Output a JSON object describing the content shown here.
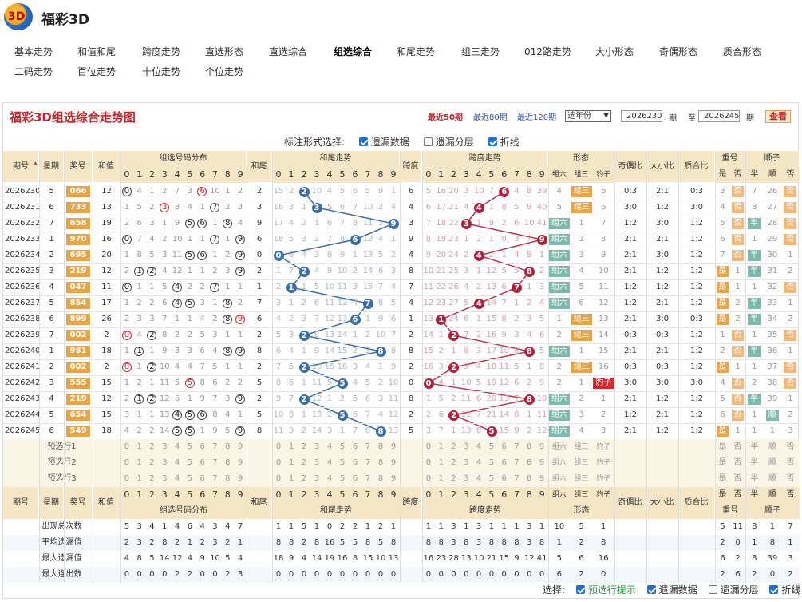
{
  "app": {
    "title": "福彩3D",
    "logo": "3D"
  },
  "nav": [
    [
      "基本走势",
      "和值和尾",
      "跨度走势",
      "直选形态",
      "直选综合",
      "组选综合",
      "和尾走势",
      "组三走势",
      "012路走势",
      "大小形态",
      "奇偶形态",
      "质合形态"
    ],
    [
      "二码走势",
      "百位走势",
      "十位走势",
      "个位走势"
    ]
  ],
  "nav_active": "组选综合",
  "panel": {
    "title": "福彩3D组选综合走势图",
    "ranges": [
      "最近50期",
      "最近80期",
      "最近120期"
    ],
    "year_select": "选年份",
    "from_label": "期",
    "to_label": "至",
    "to_suffix": "期",
    "from": "2026230",
    "to": "2026245",
    "query": "查看",
    "marker_label": "标注形式选择:",
    "marker_opts": [
      {
        "label": "遗漏数据",
        "on": true
      },
      {
        "label": "遗漏分层",
        "on": false
      },
      {
        "label": "折线",
        "on": true
      }
    ]
  },
  "columns": {
    "period": "期号",
    "week": "星期",
    "number": "奖号",
    "sum": "和值",
    "group": "组选号码分布",
    "tail": "和尾",
    "tail_trend": "和尾走势",
    "span": "跨度",
    "span_trend": "跨度走势",
    "form": "形态",
    "oe": "奇偶比",
    "bs": "大小比",
    "pc": "质合比",
    "dup": "重号",
    "seq": "顺子",
    "form_sub": [
      "组六",
      "组三",
      "豹子"
    ],
    "dup_sub": [
      "是",
      "否"
    ],
    "seq_sub": [
      "半",
      "顺",
      "否"
    ],
    "digits": [
      "0",
      "1",
      "2",
      "3",
      "4",
      "5",
      "6",
      "7",
      "8",
      "9"
    ]
  },
  "rows": [
    {
      "p": "2026230",
      "w": "5",
      "n": "066",
      "s": "12",
      "g": [
        "0",
        "4",
        "1",
        "2",
        "7",
        "3",
        "6",
        "10",
        "1",
        "2"
      ],
      "t": "2",
      "tm": [
        "15",
        "2",
        "2",
        "10",
        "4",
        "5",
        "6",
        "5",
        "9",
        "1",
        "3"
      ],
      "sp": "6",
      "spm": [
        "5",
        "16",
        "20",
        "3",
        "10",
        "7",
        "6",
        "4",
        "8",
        "39"
      ],
      "f": [
        "4",
        "组三",
        "6"
      ],
      "oe": "0:3",
      "bs": "2:1",
      "pc": "0:3",
      "d": [
        "3",
        "否"
      ],
      "q": [
        "7",
        "26",
        "否"
      ]
    },
    {
      "p": "2026231",
      "w": "6",
      "n": "733",
      "s": "13",
      "g": [
        "1",
        "5",
        "2",
        "3",
        "8",
        "4",
        "1",
        "7",
        "2",
        "3"
      ],
      "t": "3",
      "tm": [
        "16",
        "3",
        "1",
        "3",
        "5",
        "6",
        "7",
        "10",
        "2",
        "4"
      ],
      "sp": "4",
      "spm": [
        "6",
        "17",
        "21",
        "4",
        "4",
        "1",
        "8",
        "5",
        "9",
        "40"
      ],
      "f": [
        "5",
        "组三",
        "6"
      ],
      "oe": "3:0",
      "bs": "1:2",
      "pc": "3:0",
      "d": [
        "4",
        "否"
      ],
      "q": [
        "8",
        "27",
        "否"
      ]
    },
    {
      "p": "2026232",
      "w": "7",
      "n": "658",
      "s": "19",
      "g": [
        "2",
        "6",
        "3",
        "1",
        "9",
        "5",
        "6",
        "1",
        "8",
        "4"
      ],
      "t": "9",
      "tm": [
        "17",
        "4",
        "2",
        "1",
        "6",
        "7",
        "8",
        "11",
        "3",
        "9"
      ],
      "sp": "3",
      "spm": [
        "7",
        "18",
        "22",
        "3",
        "1",
        "9",
        "2",
        "6",
        "10",
        "41"
      ],
      "f": [
        "组六",
        "1",
        "7"
      ],
      "oe": "1:2",
      "bs": "3:0",
      "pc": "1:2",
      "d": [
        "5",
        "否"
      ],
      "q": [
        "半",
        "28",
        "否"
      ]
    },
    {
      "p": "2026233",
      "w": "1",
      "n": "970",
      "s": "16",
      "g": [
        "0",
        "7",
        "4",
        "2",
        "10",
        "1",
        "1",
        "7",
        "1",
        "9"
      ],
      "t": "6",
      "tm": [
        "18",
        "5",
        "3",
        "2",
        "7",
        "8",
        "6",
        "12",
        "4",
        "1"
      ],
      "sp": "9",
      "spm": [
        "8",
        "19",
        "23",
        "1",
        "2",
        "1",
        "0",
        "3",
        "7",
        "9"
      ],
      "f": [
        "组六",
        "2",
        "8"
      ],
      "oe": "2:1",
      "bs": "2:1",
      "pc": "1:2",
      "d": [
        "6",
        "否"
      ],
      "q": [
        "1",
        "29",
        "否"
      ]
    },
    {
      "p": "2026234",
      "w": "2",
      "n": "695",
      "s": "20",
      "g": [
        "1",
        "8",
        "5",
        "3",
        "11",
        "5",
        "6",
        "1",
        "2",
        "9"
      ],
      "t": "0",
      "tm": [
        "0",
        "6",
        "4",
        "3",
        "8",
        "9",
        "1",
        "13",
        "5",
        "2"
      ],
      "sp": "4",
      "spm": [
        "9",
        "20",
        "24",
        "2",
        "4",
        "2",
        "1",
        "4",
        "8",
        "1"
      ],
      "f": [
        "组六",
        "3",
        "9"
      ],
      "oe": "2:1",
      "bs": "3:0",
      "pc": "1:2",
      "d": [
        "7",
        "否"
      ],
      "q": [
        "半",
        "30",
        "1"
      ]
    },
    {
      "p": "2026235",
      "w": "3",
      "n": "219",
      "s": "12",
      "g": [
        "2",
        "1",
        "2",
        "4",
        "12",
        "1",
        "1",
        "2",
        "3",
        "9"
      ],
      "t": "2",
      "tm": [
        "1",
        "7",
        "2",
        "4",
        "9",
        "10",
        "2",
        "14",
        "6",
        "3"
      ],
      "sp": "8",
      "spm": [
        "10",
        "21",
        "25",
        "3",
        "1",
        "12",
        "5",
        "5",
        "8",
        "2"
      ],
      "f": [
        "组六",
        "4",
        "10"
      ],
      "oe": "2:1",
      "bs": "1:2",
      "pc": "1:2",
      "d": [
        "是",
        "1"
      ],
      "q": [
        "半",
        "31",
        "2"
      ]
    },
    {
      "p": "2026236",
      "w": "4",
      "n": "047",
      "s": "11",
      "g": [
        "0",
        "1",
        "1",
        "5",
        "4",
        "2",
        "2",
        "7",
        "1",
        "1"
      ],
      "t": "1",
      "tm": [
        "2",
        "1",
        "1",
        "5",
        "10",
        "11",
        "3",
        "15",
        "7",
        "4"
      ],
      "sp": "7",
      "spm": [
        "11",
        "22",
        "26",
        "4",
        "2",
        "13",
        "6",
        "7",
        "1",
        "3"
      ],
      "f": [
        "组六",
        "5",
        "11"
      ],
      "oe": "1:2",
      "bs": "1:2",
      "pc": "1:2",
      "d": [
        "是",
        "1"
      ],
      "q": [
        "1",
        "32",
        "否"
      ]
    },
    {
      "p": "2026237",
      "w": "5",
      "n": "854",
      "s": "17",
      "g": [
        "1",
        "2",
        "2",
        "6",
        "4",
        "5",
        "3",
        "1",
        "8",
        "2"
      ],
      "t": "7",
      "tm": [
        "3",
        "1",
        "2",
        "6",
        "11",
        "12",
        "4",
        "7",
        "8",
        "5"
      ],
      "sp": "4",
      "spm": [
        "12",
        "23",
        "27",
        "5",
        "4",
        "14",
        "7",
        "1",
        "2",
        "4"
      ],
      "f": [
        "组六",
        "6",
        "12"
      ],
      "oe": "1:2",
      "bs": "2:1",
      "pc": "1:2",
      "d": [
        "是",
        "2"
      ],
      "q": [
        "半",
        "33",
        "1"
      ]
    },
    {
      "p": "2026238",
      "w": "6",
      "n": "899",
      "s": "26",
      "g": [
        "2",
        "3",
        "3",
        "7",
        "1",
        "1",
        "4",
        "2",
        "8",
        "9"
      ],
      "t": "6",
      "tm": [
        "4",
        "2",
        "3",
        "7",
        "12",
        "13",
        "6",
        "1",
        "9",
        "6"
      ],
      "sp": "1",
      "spm": [
        "13",
        "1",
        "24",
        "6",
        "1",
        "15",
        "8",
        "2",
        "3",
        "5"
      ],
      "f": [
        "1",
        "组三",
        "13"
      ],
      "oe": "2:1",
      "bs": "3:0",
      "pc": "0:3",
      "d": [
        "是",
        "2"
      ],
      "q": [
        "半",
        "34",
        "2"
      ]
    },
    {
      "p": "2026239",
      "w": "7",
      "n": "002",
      "s": "2",
      "g": [
        "0",
        "4",
        "2",
        "8",
        "2",
        "2",
        "5",
        "3",
        "1",
        "1"
      ],
      "t": "2",
      "tm": [
        "5",
        "3",
        "2",
        "8",
        "13",
        "14",
        "1",
        "2",
        "10",
        "7"
      ],
      "sp": "2",
      "spm": [
        "14",
        "1",
        "2",
        "7",
        "2",
        "16",
        "9",
        "3",
        "4",
        "6"
      ],
      "f": [
        "2",
        "组三",
        "14"
      ],
      "oe": "0:3",
      "bs": "0:3",
      "pc": "1:2",
      "d": [
        "1",
        "否"
      ],
      "q": [
        "1",
        "35",
        "否"
      ]
    },
    {
      "p": "2026240",
      "w": "1",
      "n": "981",
      "s": "18",
      "g": [
        "1",
        "1",
        "1",
        "9",
        "3",
        "3",
        "6",
        "4",
        "8",
        "9"
      ],
      "t": "8",
      "tm": [
        "6",
        "4",
        "1",
        "9",
        "14",
        "15",
        "2",
        "3",
        "8",
        "8"
      ],
      "sp": "8",
      "spm": [
        "15",
        "2",
        "1",
        "8",
        "3",
        "17",
        "10",
        "8",
        "7",
        "5"
      ],
      "f": [
        "组六",
        "1",
        "15"
      ],
      "oe": "2:1",
      "bs": "2:1",
      "pc": "1:2",
      "d": [
        "2",
        "否"
      ],
      "q": [
        "半",
        "36",
        "1"
      ]
    },
    {
      "p": "2026241",
      "w": "2",
      "n": "002",
      "s": "2",
      "g": [
        "0",
        "1",
        "2",
        "10",
        "4",
        "4",
        "7",
        "5",
        "1",
        "1"
      ],
      "t": "2",
      "tm": [
        "7",
        "5",
        "2",
        "10",
        "15",
        "16",
        "3",
        "4",
        "1",
        "9"
      ],
      "sp": "2",
      "spm": [
        "16",
        "3",
        "2",
        "9",
        "4",
        "18",
        "11",
        "5",
        "1",
        "8"
      ],
      "f": [
        "2",
        "组三",
        "16"
      ],
      "oe": "0:3",
      "bs": "0:3",
      "pc": "1:2",
      "d": [
        "是",
        "1"
      ],
      "q": [
        "1",
        "37",
        "否"
      ]
    },
    {
      "p": "2026242",
      "w": "3",
      "n": "555",
      "s": "15",
      "g": [
        "1",
        "2",
        "1",
        "11",
        "5",
        "5",
        "8",
        "6",
        "2",
        "2"
      ],
      "t": "5",
      "tm": [
        "8",
        "6",
        "1",
        "11",
        "5",
        "1",
        "4",
        "5",
        "2",
        "10"
      ],
      "sp": "0",
      "spm": [
        "0",
        "4",
        "1",
        "10",
        "5",
        "19",
        "12",
        "6",
        "2",
        "9"
      ],
      "f": [
        "2",
        "1",
        "豹子"
      ],
      "oe": "3:0",
      "bs": "3:0",
      "pc": "3:0",
      "d": [
        "4",
        "否"
      ],
      "q": [
        "2",
        "38",
        "否"
      ]
    },
    {
      "p": "2026243",
      "w": "4",
      "n": "219",
      "s": "12",
      "g": [
        "2",
        "1",
        "2",
        "12",
        "6",
        "1",
        "9",
        "7",
        "3",
        "9"
      ],
      "t": "2",
      "tm": [
        "9",
        "7",
        "2",
        "12",
        "1",
        "2",
        "5",
        "6",
        "3",
        "11"
      ],
      "sp": "8",
      "spm": [
        "1",
        "5",
        "2",
        "11",
        "6",
        "20",
        "13",
        "7",
        "8",
        "10"
      ],
      "f": [
        "组六",
        "2",
        "1"
      ],
      "oe": "2:1",
      "bs": "1:2",
      "pc": "1:2",
      "d": [
        "5",
        "否"
      ],
      "q": [
        "半",
        "39",
        "1"
      ]
    },
    {
      "p": "2026244",
      "w": "5",
      "n": "654",
      "s": "15",
      "g": [
        "3",
        "1",
        "1",
        "13",
        "4",
        "5",
        "6",
        "8",
        "4",
        "1"
      ],
      "t": "5",
      "tm": [
        "10",
        "8",
        "1",
        "13",
        "2",
        "5",
        "6",
        "7",
        "4",
        "12"
      ],
      "sp": "2",
      "spm": [
        "2",
        "6",
        "2",
        "12",
        "7",
        "21",
        "14",
        "8",
        "1",
        "11"
      ],
      "f": [
        "组六",
        "3",
        "2"
      ],
      "oe": "1:2",
      "bs": "2:1",
      "pc": "1:2",
      "d": [
        "6",
        "否"
      ],
      "q": [
        "1",
        "顺",
        "2"
      ]
    },
    {
      "p": "2026245",
      "w": "6",
      "n": "549",
      "s": "18",
      "g": [
        "4",
        "2",
        "2",
        "14",
        "5",
        "5",
        "1",
        "9",
        "5",
        "9"
      ],
      "t": "8",
      "tm": [
        "11",
        "9",
        "2",
        "14",
        "3",
        "1",
        "7",
        "8",
        "8",
        "13"
      ],
      "sp": "5",
      "spm": [
        "3",
        "7",
        "1",
        "13",
        "8",
        "5",
        "15",
        "9",
        "2",
        "12"
      ],
      "f": [
        "组六",
        "4",
        "3"
      ],
      "oe": "2:1",
      "bs": "1:2",
      "pc": "1:2",
      "d": [
        "是",
        "1"
      ],
      "q": [
        "1",
        "1",
        "3"
      ]
    }
  ],
  "predict": [
    "预选行1",
    "预选行2",
    "预选行3"
  ],
  "stats": [
    {
      "label": "出现总次数",
      "g": [
        "5",
        "3",
        "4",
        "1",
        "4",
        "6",
        "4",
        "3",
        "4",
        "7"
      ],
      "tm": [
        "1",
        "1",
        "5",
        "1",
        "0",
        "2",
        "2",
        "1",
        "2",
        "1"
      ],
      "spm": [
        "1",
        "1",
        "3",
        "1",
        "3",
        "1",
        "1",
        "1",
        "3",
        "1"
      ],
      "f": [
        "10",
        "5",
        "1"
      ],
      "d": [
        "5",
        "11"
      ],
      "q": [
        "8",
        "1",
        "7"
      ]
    },
    {
      "label": "平均遗漏值",
      "g": [
        "2",
        "3",
        "2",
        "8",
        "2",
        "1",
        "2",
        "3",
        "2",
        "1"
      ],
      "tm": [
        "8",
        "8",
        "2",
        "8",
        "16",
        "5",
        "5",
        "8",
        "5",
        "8"
      ],
      "spm": [
        "8",
        "8",
        "3",
        "8",
        "3",
        "8",
        "8",
        "8",
        "3",
        "8"
      ],
      "f": [
        "1",
        "2",
        "8"
      ],
      "d": [
        "2",
        "0"
      ],
      "q": [
        "1",
        "8",
        "1"
      ]
    },
    {
      "label": "最大遗漏值",
      "g": [
        "4",
        "8",
        "5",
        "14",
        "12",
        "4",
        "9",
        "10",
        "5",
        "4"
      ],
      "tm": [
        "18",
        "9",
        "4",
        "14",
        "19",
        "16",
        "8",
        "15",
        "10",
        "13"
      ],
      "spm": [
        "16",
        "23",
        "28",
        "13",
        "10",
        "21",
        "15",
        "9",
        "12",
        "41"
      ],
      "f": [
        "5",
        "6",
        "16"
      ],
      "d": [
        "6",
        "2"
      ],
      "q": [
        "8",
        "39",
        "3"
      ]
    },
    {
      "label": "最大连出数",
      "g": [
        "0",
        "0",
        "0",
        "0",
        "2",
        "2",
        "0",
        "0",
        "2",
        "3"
      ],
      "tm": [
        "0",
        "0",
        "0",
        "0",
        "0",
        "0",
        "0",
        "0",
        "0",
        "0"
      ],
      "spm": [
        "0",
        "0",
        "0",
        "0",
        "0",
        "0",
        "0",
        "0",
        "0",
        "0"
      ],
      "f": [
        "6",
        "2",
        "0"
      ],
      "d": [
        "2",
        "6"
      ],
      "q": [
        "2",
        "0",
        "2"
      ]
    }
  ],
  "bottom": {
    "label": "选择:",
    "opts": [
      {
        "label": "预选行提示",
        "on": true
      },
      {
        "label": "遗漏数据",
        "on": true
      },
      {
        "label": "遗漏分层",
        "on": false
      },
      {
        "label": "折线",
        "on": true
      }
    ]
  },
  "colors": {
    "accent": "#c1272d",
    "blue": "#3a6ea8",
    "red": "#c23350",
    "gold": "#e5a54b",
    "green": "#7fb8ac",
    "header": "#f5e6c6"
  }
}
